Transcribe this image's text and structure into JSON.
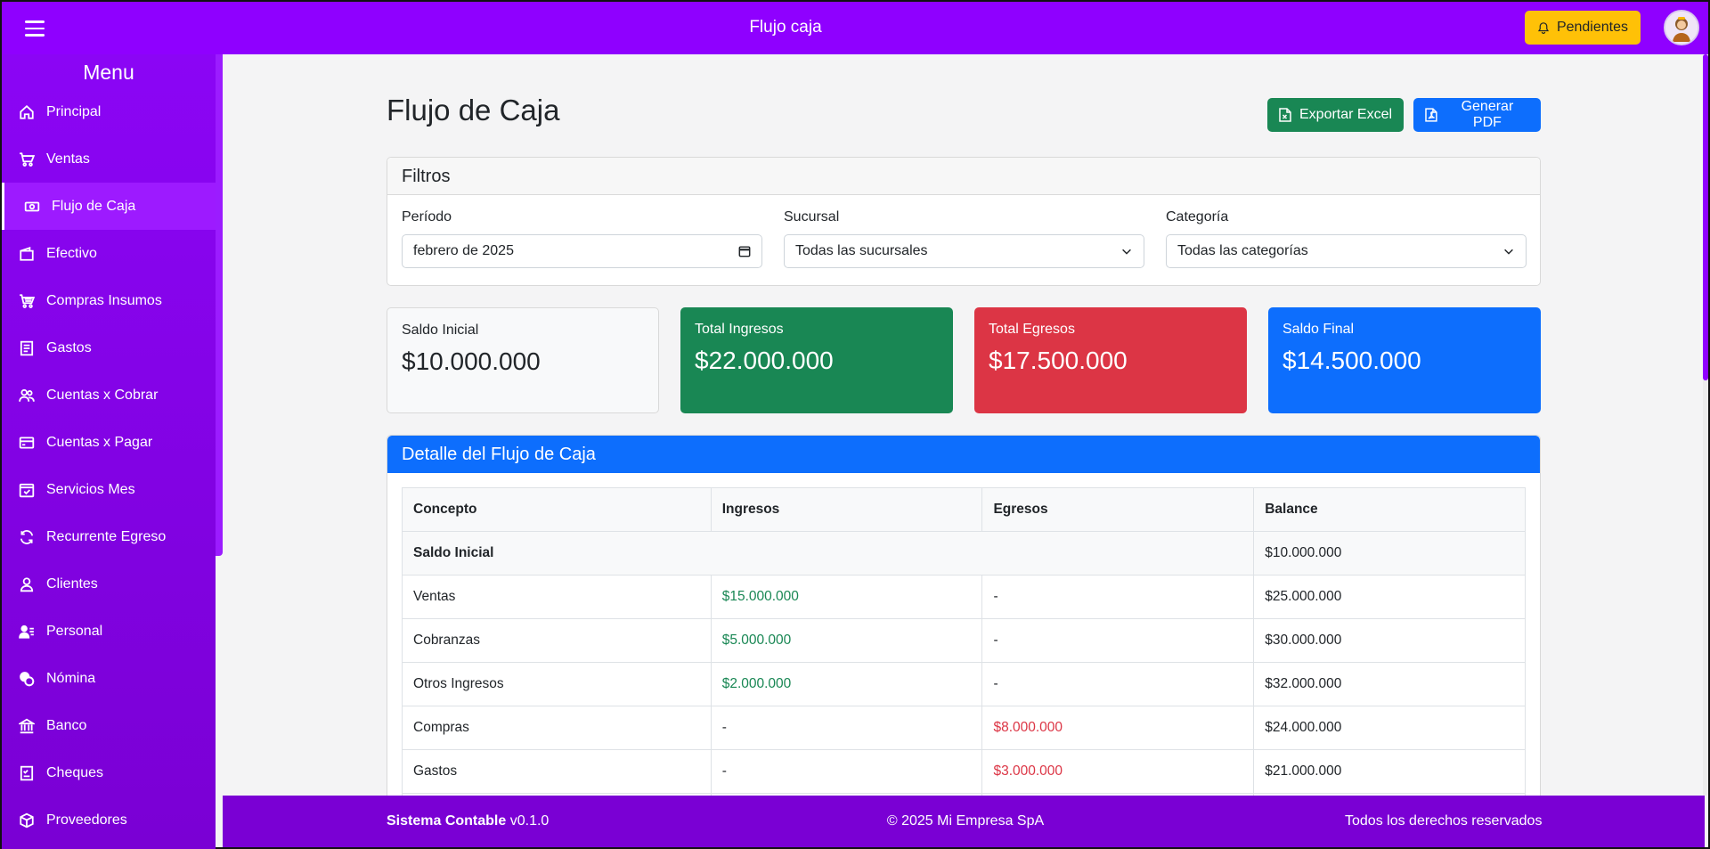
{
  "topbar": {
    "title": "Flujo caja",
    "pending_label": "Pendientes"
  },
  "sidebar": {
    "title": "Menu",
    "items": [
      {
        "label": "Principal",
        "icon": "home-icon"
      },
      {
        "label": "Ventas",
        "icon": "cart-icon"
      },
      {
        "label": "Flujo de Caja",
        "icon": "cash-icon",
        "active": true
      },
      {
        "label": "Efectivo",
        "icon": "wallet-icon"
      },
      {
        "label": "Compras Insumos",
        "icon": "cart-full-icon"
      },
      {
        "label": "Gastos",
        "icon": "receipt-icon"
      },
      {
        "label": "Cuentas x Cobrar",
        "icon": "people-icon"
      },
      {
        "label": "Cuentas x Pagar",
        "icon": "credit-card-icon"
      },
      {
        "label": "Servicios Mes",
        "icon": "calendar-check-icon"
      },
      {
        "label": "Recurrente Egreso",
        "icon": "refresh-icon"
      },
      {
        "label": "Clientes",
        "icon": "person-icon"
      },
      {
        "label": "Personal",
        "icon": "person-lines-icon"
      },
      {
        "label": "Nómina",
        "icon": "coins-icon"
      },
      {
        "label": "Banco",
        "icon": "bank-icon"
      },
      {
        "label": "Cheques",
        "icon": "check-list-icon"
      },
      {
        "label": "Proveedores",
        "icon": "box-icon"
      }
    ]
  },
  "page": {
    "title": "Flujo de Caja",
    "export_excel": "Exportar Excel",
    "generate_pdf": "Generar PDF"
  },
  "filters": {
    "title": "Filtros",
    "period_label": "Período",
    "period_value": "febrero de 2025",
    "branch_label": "Sucursal",
    "branch_value": "Todas las sucursales",
    "category_label": "Categoría",
    "category_value": "Todas las categorías"
  },
  "stats": {
    "initial_label": "Saldo Inicial",
    "initial_value": "$10.000.000",
    "income_label": "Total Ingresos",
    "income_value": "$22.000.000",
    "expense_label": "Total Egresos",
    "expense_value": "$17.500.000",
    "final_label": "Saldo Final",
    "final_value": "$14.500.000"
  },
  "detail": {
    "title": "Detalle del Flujo de Caja",
    "headers": [
      "Concepto",
      "Ingresos",
      "Egresos",
      "Balance"
    ],
    "initial_row": {
      "concept": "Saldo Inicial",
      "balance": "$10.000.000"
    },
    "rows": [
      {
        "concept": "Ventas",
        "income": "$15.000.000",
        "expense": "-",
        "balance": "$25.000.000"
      },
      {
        "concept": "Cobranzas",
        "income": "$5.000.000",
        "expense": "-",
        "balance": "$30.000.000"
      },
      {
        "concept": "Otros Ingresos",
        "income": "$2.000.000",
        "expense": "-",
        "balance": "$32.000.000"
      },
      {
        "concept": "Compras",
        "income": "-",
        "expense": "$8.000.000",
        "balance": "$24.000.000"
      },
      {
        "concept": "Gastos",
        "income": "-",
        "expense": "$3.000.000",
        "balance": "$21.000.000"
      },
      {
        "concept": "",
        "income": "",
        "expense": "",
        "balance": ""
      }
    ]
  },
  "footer": {
    "app_name": "Sistema Contable",
    "version": "v0.1.0",
    "copyright": "© 2025 Mi Empresa SpA",
    "rights": "Todos los derechos reservados"
  },
  "colors": {
    "brand_purple": "#8f00ff",
    "sidebar_purple": "#7a00d4",
    "success": "#198754",
    "danger": "#dc3545",
    "primary": "#0d6efd",
    "warning": "#ffc107"
  }
}
